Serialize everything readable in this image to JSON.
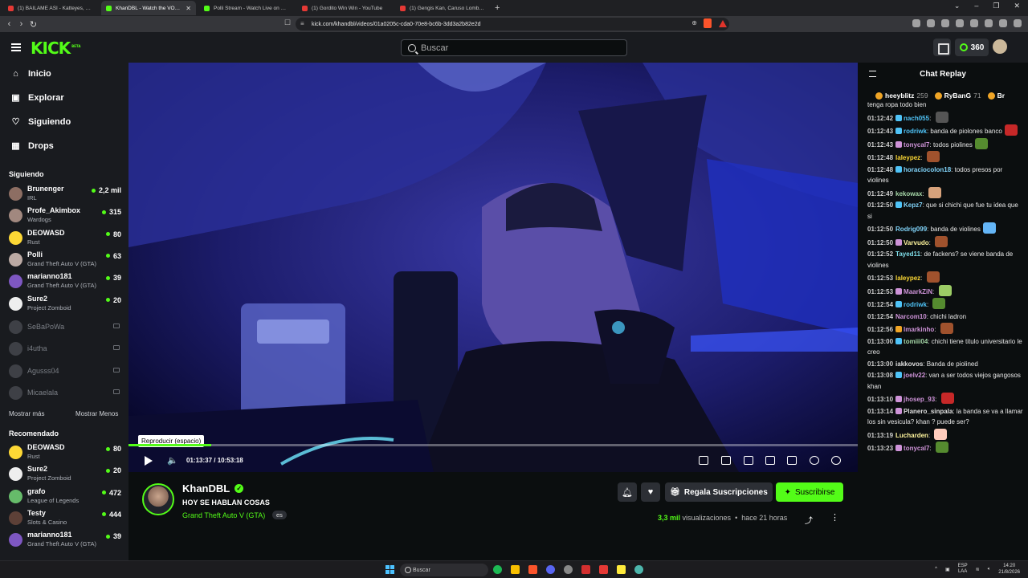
{
  "browser": {
    "tabs": [
      {
        "title": "(1) BAILAME ASI - Katteyes, Jere Kl...",
        "favicon_color": "#e53935",
        "active": false
      },
      {
        "title": "KhanDBL - Watch the VOD on K...",
        "favicon_color": "#53fc18",
        "active": true
      },
      {
        "title": "Polli Stream - Watch Live on Kick",
        "favicon_color": "#53fc18",
        "active": false
      },
      {
        "title": "(1) Gordito Win Win - YouTube",
        "favicon_color": "#e53935",
        "active": false
      },
      {
        "title": "(1) Gengis Kan, Caruso Lombardi y P...",
        "favicon_color": "#e53935",
        "active": false
      }
    ],
    "url": "kick.com/khandbl/videos/01a0205c-cda0-70e8-bc6b-3dd3a2b82e2d"
  },
  "header": {
    "logo": "KICK",
    "logo_sup": "BETA",
    "search_placeholder": "Buscar",
    "points": "360",
    "accent": "#53fc18"
  },
  "sidebar": {
    "nav": [
      {
        "label": "Inicio",
        "icon": "home-icon"
      },
      {
        "label": "Explorar",
        "icon": "compass-icon"
      },
      {
        "label": "Siguiendo",
        "icon": "heart-icon"
      },
      {
        "label": "Drops",
        "icon": "drops-icon"
      }
    ],
    "following_title": "Siguiendo",
    "following": [
      {
        "name": "Brunenger",
        "category": "IRL",
        "viewers": "2,2 mil",
        "color": "#8d6e63"
      },
      {
        "name": "Profe_Akimbox",
        "category": "Wardogs",
        "viewers": "315",
        "color": "#a1887f"
      },
      {
        "name": "DEOWASD",
        "category": "Rust",
        "viewers": "80",
        "color": "#fdd835"
      },
      {
        "name": "Polli",
        "category": "Grand Theft Auto V (GTA)",
        "viewers": "63",
        "color": "#bcaaa4"
      },
      {
        "name": "marianno181",
        "category": "Grand Theft Auto V (GTA)",
        "viewers": "39",
        "color": "#7e57c2"
      },
      {
        "name": "Sure2",
        "category": "Project Zomboid",
        "viewers": "20",
        "color": "#eeeeee"
      }
    ],
    "offline": [
      "SeBaPoWa",
      "i4utha",
      "Agusss04",
      "Micaelala"
    ],
    "show_more": "Mostrar más",
    "show_less": "Mostrar Menos",
    "recommended_title": "Recomendado",
    "recommended": [
      {
        "name": "DEOWASD",
        "category": "Rust",
        "viewers": "80",
        "color": "#fdd835"
      },
      {
        "name": "Sure2",
        "category": "Project Zomboid",
        "viewers": "20",
        "color": "#eeeeee"
      },
      {
        "name": "grafo",
        "category": "League of Legends",
        "viewers": "472",
        "color": "#66bb6a"
      },
      {
        "name": "Testy",
        "category": "Slots & Casino",
        "viewers": "444",
        "color": "#5d4037"
      },
      {
        "name": "marianno181",
        "category": "Grand Theft Auto V (GTA)",
        "viewers": "39",
        "color": "#7e57c2"
      }
    ]
  },
  "player": {
    "tooltip": "Reproducir (espacio)",
    "current_time": "01:13:37",
    "duration": "10:53:18",
    "time_separator": "/",
    "progress": 0.113
  },
  "stream": {
    "channel": "KhanDBL",
    "title": "HOY SE HABLAN COSAS",
    "category": "Grand Theft Auto V (GTA)",
    "language": "es",
    "gift_label": "Regala Suscripciones",
    "subscribe_label": "Suscribirse",
    "views": "3,3 mil",
    "views_label": "visualizaciones",
    "ago": "hace 21 horas"
  },
  "chat": {
    "title": "Chat Replay",
    "gifters": [
      {
        "name": "heeyblitz",
        "count": "259"
      },
      {
        "name": "RyBanG",
        "count": "71"
      },
      {
        "name": "Br",
        "count": ""
      }
    ],
    "first_line": "tenga ropa todo bien",
    "messages": [
      {
        "t": "01:12:42",
        "user": "nach055",
        "color": "#4fc3f7",
        "text": "",
        "badge": "#4fc3f7",
        "emote": "#555"
      },
      {
        "t": "01:12:43",
        "user": "rodriwk",
        "color": "#4fc3f7",
        "text": "banda de piolones banco",
        "badge": "#4fc3f7",
        "emote": "#c62828"
      },
      {
        "t": "01:12:43",
        "user": "tonycal7",
        "color": "#ce93d8",
        "text": "todos piolines",
        "badge": "#ce93d8",
        "emote": "#558b2f"
      },
      {
        "t": "01:12:48",
        "user": "laleypez",
        "color": "#fdd835",
        "text": "",
        "badge": "",
        "emote": "#a0522d"
      },
      {
        "t": "01:12:48",
        "user": "horaciocolon18",
        "color": "#81d4fa",
        "text": "todos presos por violines",
        "badge": "#4fc3f7",
        "emote": ""
      },
      {
        "t": "01:12:49",
        "user": "kekowax",
        "color": "#a5d6a7",
        "text": "",
        "badge": "",
        "emote": "#d7a27b"
      },
      {
        "t": "01:12:50",
        "user": "Kepz7",
        "color": "#81d4fa",
        "text": "que si chichi que fue tu idea que si",
        "badge": "#4fc3f7",
        "emote": ""
      },
      {
        "t": "01:12:50",
        "user": "Rodrig099",
        "color": "#81d4fa",
        "text": "banda de violines",
        "badge": "",
        "emote": "#64b5f6"
      },
      {
        "t": "01:12:50",
        "user": "Varvudo",
        "color": "#fff59d",
        "text": "",
        "badge": "#ce93d8",
        "emote": "#a0522d"
      },
      {
        "t": "01:12:52",
        "user": "Tayed11",
        "color": "#80deea",
        "text": "de fackens? se viene banda de violines",
        "badge": "",
        "emote": ""
      },
      {
        "t": "01:12:53",
        "user": "laleypez",
        "color": "#fdd835",
        "text": "",
        "badge": "",
        "emote": "#a0522d"
      },
      {
        "t": "01:12:53",
        "user": "MaarkZiN",
        "color": "#ce93d8",
        "text": "",
        "badge": "#ce93d8",
        "emote": "#9ccc65"
      },
      {
        "t": "01:12:54",
        "user": "rodriwk",
        "color": "#4fc3f7",
        "text": "",
        "badge": "#4fc3f7",
        "emote": "#558b2f"
      },
      {
        "t": "01:12:54",
        "user": "Narcom10",
        "color": "#ce93d8",
        "text": "chichi ladron",
        "badge": "",
        "emote": ""
      },
      {
        "t": "01:12:56",
        "user": "lmarkinho",
        "color": "#ce93d8",
        "text": "",
        "badge": "#f0a526",
        "emote": "#a0522d"
      },
      {
        "t": "01:13:00",
        "user": "tomiii04",
        "color": "#a5d6a7",
        "text": "chichi tiene titulo universitario le creo",
        "badge": "#4fc3f7",
        "emote": ""
      },
      {
        "t": "01:13:00",
        "user": "iakkovos",
        "color": "#e0e0e0",
        "text": "Banda de piolined",
        "badge": "",
        "emote": ""
      },
      {
        "t": "01:13:08",
        "user": "joelv22",
        "color": "#ce93d8",
        "text": "van a ser todos viejos gangosos khan",
        "badge": "#4fc3f7",
        "emote": ""
      },
      {
        "t": "01:13:10",
        "user": "jhosep_93",
        "color": "#ce93d8",
        "text": "",
        "badge": "#ce93d8",
        "emote": "#c62828"
      },
      {
        "t": "01:13:14",
        "user": "Planero_sinpala",
        "color": "#e0e0e0",
        "text": "la banda se va a llamar los sin vesicula? khan ? puede ser?",
        "badge": "#ce93d8",
        "emote": ""
      },
      {
        "t": "01:13:19",
        "user": "Lucharden",
        "color": "#fff59d",
        "text": "",
        "badge": "",
        "emote": "#ffccbc"
      },
      {
        "t": "01:13:23",
        "user": "tonycal7",
        "color": "#ce93d8",
        "text": "",
        "badge": "#ce93d8",
        "emote": "#558b2f"
      }
    ]
  },
  "taskbar": {
    "search_placeholder": "Buscar",
    "lang": "ESP",
    "lang2": "LAA",
    "time": "14:20",
    "date": "21/8/2026"
  }
}
